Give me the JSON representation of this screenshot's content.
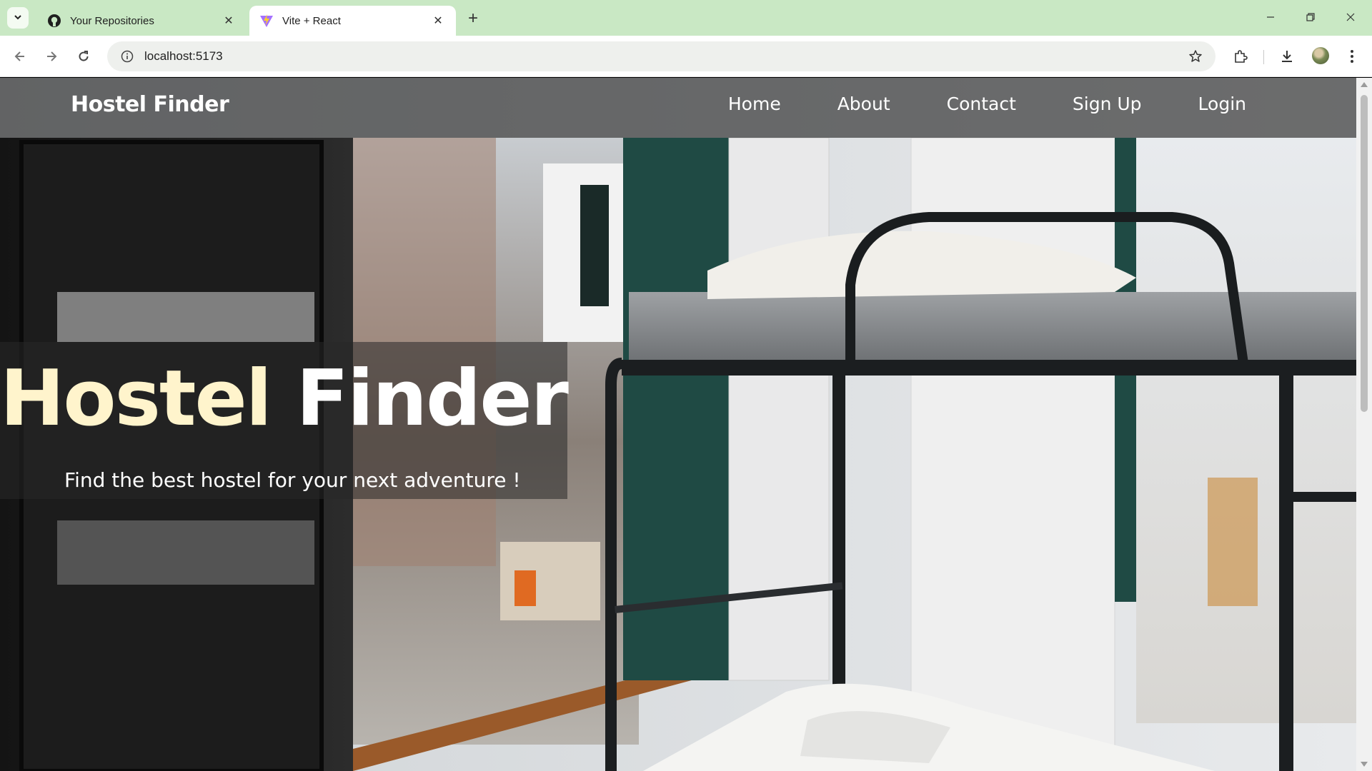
{
  "browser": {
    "tabs": [
      {
        "title": "Your Repositories",
        "favicon": "github-icon",
        "active": false
      },
      {
        "title": "Vite + React",
        "favicon": "vite-icon",
        "active": true
      }
    ],
    "address": "localhost:5173",
    "accent_color": "#c9e8c4"
  },
  "site": {
    "brand": "Hostel Finder",
    "nav": [
      "Home",
      "About",
      "Contact",
      "Sign Up",
      "Login"
    ],
    "hero": {
      "title_word1": "Hostel",
      "title_word2": "Finder",
      "subtitle": "Find the best hostel for your next adventure !"
    },
    "colors": {
      "title_accent": "#fff4cc",
      "nav_bg": "#1e1e1e"
    }
  }
}
